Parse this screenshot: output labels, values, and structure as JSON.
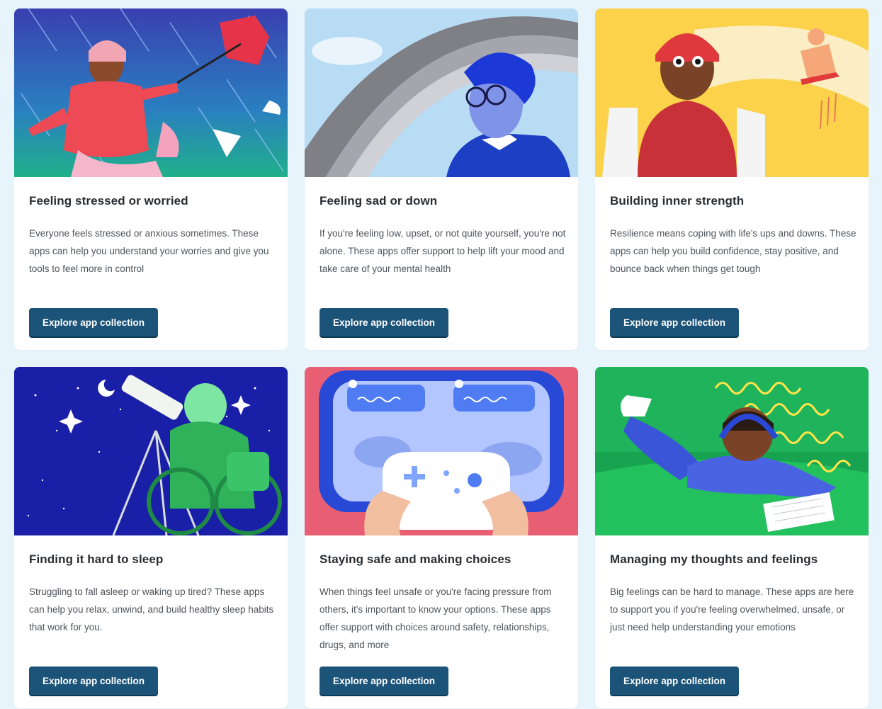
{
  "cards": [
    {
      "title": "Feeling stressed or worried",
      "description": "Everyone feels stressed or anxious sometimes. These apps can help you understand your worries and give you tools to feel more in control",
      "button_label": "Explore app collection",
      "illustration": "person-in-rain-with-umbrella"
    },
    {
      "title": "Feeling sad or down",
      "description": "If you're feeling low, upset, or not quite yourself, you're not alone. These apps offer support to help lift your mood and take care of your mental health",
      "button_label": "Explore app collection",
      "illustration": "boy-looking-at-rainbow"
    },
    {
      "title": "Building inner strength",
      "description": "Resilience means coping with life's ups and downs. These apps can help you build confidence, stay positive, and bounce back when things get tough",
      "button_label": "Explore app collection",
      "illustration": "girl-in-helmet-at-skatepark"
    },
    {
      "title": "Finding it hard to sleep",
      "description": "Struggling to fall asleep or waking up tired? These apps can help you relax, unwind, and build healthy sleep habits that work for you.",
      "button_label": "Explore app collection",
      "illustration": "person-with-telescope-at-night"
    },
    {
      "title": "Staying safe and making choices",
      "description": "When things feel unsafe or you're facing pressure from others, it's important to know your options. These apps offer support with choices around safety, relationships, drugs, and more",
      "button_label": "Explore app collection",
      "illustration": "hands-holding-game-controller"
    },
    {
      "title": "Managing my thoughts and feelings",
      "description": "Big feelings can be hard to manage. These apps are here to support you if you're feeling overwhelmed, unsafe, or just need help understanding your emotions",
      "button_label": "Explore app collection",
      "illustration": "teen-with-headphones-writing"
    }
  ],
  "colors": {
    "page_background": "#e8f4fb",
    "card_background": "#ffffff",
    "button_background": "#1b5478",
    "title_text": "#262d33",
    "body_text": "#4d555c"
  }
}
